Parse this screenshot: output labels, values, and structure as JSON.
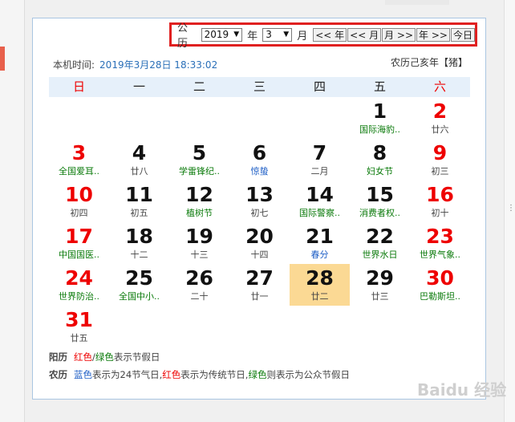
{
  "calendar_type": "公历",
  "year": "2019",
  "year_unit": "年",
  "month": "3",
  "month_unit": "月",
  "nav": {
    "prev_year": "<< 年",
    "prev_month": "<< 月",
    "next_month": "月 >>",
    "next_year": "年 >>",
    "today": "今日"
  },
  "local_time_label": "本机时间:",
  "local_time": "2019年3月28日 18:33:02",
  "lunar_year": "农历己亥年【猪】",
  "weekdays": [
    "日",
    "一",
    "二",
    "三",
    "四",
    "五",
    "六"
  ],
  "days": [
    {
      "n": "1",
      "sub": "国际海豹..",
      "c": "green"
    },
    {
      "n": "2",
      "sub": "廿六",
      "c": ""
    },
    {
      "n": "3",
      "sub": "全国爱耳..",
      "c": "green"
    },
    {
      "n": "4",
      "sub": "廿八",
      "c": ""
    },
    {
      "n": "5",
      "sub": "学雷锋纪..",
      "c": "green"
    },
    {
      "n": "6",
      "sub": "惊蛰",
      "c": "blue"
    },
    {
      "n": "7",
      "sub": "二月",
      "c": ""
    },
    {
      "n": "8",
      "sub": "妇女节",
      "c": "green"
    },
    {
      "n": "9",
      "sub": "初三",
      "c": ""
    },
    {
      "n": "10",
      "sub": "初四",
      "c": ""
    },
    {
      "n": "11",
      "sub": "初五",
      "c": ""
    },
    {
      "n": "12",
      "sub": "植树节",
      "c": "green"
    },
    {
      "n": "13",
      "sub": "初七",
      "c": ""
    },
    {
      "n": "14",
      "sub": "国际警察..",
      "c": "green"
    },
    {
      "n": "15",
      "sub": "消费者权..",
      "c": "green"
    },
    {
      "n": "16",
      "sub": "初十",
      "c": ""
    },
    {
      "n": "17",
      "sub": "中国国医..",
      "c": "green"
    },
    {
      "n": "18",
      "sub": "十二",
      "c": ""
    },
    {
      "n": "19",
      "sub": "十三",
      "c": ""
    },
    {
      "n": "20",
      "sub": "十四",
      "c": ""
    },
    {
      "n": "21",
      "sub": "春分",
      "c": "blue"
    },
    {
      "n": "22",
      "sub": "世界水日",
      "c": "green"
    },
    {
      "n": "23",
      "sub": "世界气象..",
      "c": "green"
    },
    {
      "n": "24",
      "sub": "世界防治..",
      "c": "green"
    },
    {
      "n": "25",
      "sub": "全国中小..",
      "c": "green"
    },
    {
      "n": "26",
      "sub": "二十",
      "c": ""
    },
    {
      "n": "27",
      "sub": "廿一",
      "c": ""
    },
    {
      "n": "28",
      "sub": "廿二",
      "c": ""
    },
    {
      "n": "29",
      "sub": "廿三",
      "c": ""
    },
    {
      "n": "30",
      "sub": "巴勒斯坦..",
      "c": "green"
    },
    {
      "n": "31",
      "sub": "廿五",
      "c": ""
    }
  ],
  "first_weekday_index": 5,
  "today_day": "28",
  "legend_solar": {
    "label": "阳历",
    "red": "红色",
    "slash": "/",
    "green": "绿色",
    "text": "表示节假日"
  },
  "legend_lunar": {
    "label": "农历",
    "blue": "蓝色",
    "t1": "表示为24节气日,",
    "red": "红色",
    "t2": "表示为传统节日,",
    "green": "绿色",
    "t3": "则表示为公众节假日"
  },
  "watermark": "Baidu 经验",
  "colors": {
    "red": "#e00000",
    "green": "#0a7a0a",
    "blue": "#1f5fc6",
    "today_bg": "#fbd994",
    "header_bg": "#e6f0fa",
    "highlight_border": "#e02020"
  }
}
